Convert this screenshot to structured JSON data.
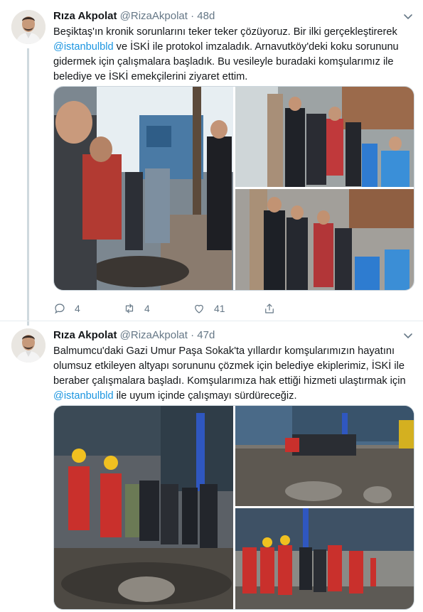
{
  "tweets": [
    {
      "author_name": "Rıza Akpolat",
      "handle": "@RizaAkpolat",
      "separator": "·",
      "time": "48d",
      "text_parts": {
        "p1": "Beşiktaş'ın kronik sorunlarını teker teker çözüyoruz. Bir ilki gerçekleştirerek",
        "mention1": "@istanbulbld",
        "p2": " ve İSKİ ile protokol imzaladık. Arnavutköy'deki koku sorununu gidermek için çalışmalara başladık. Bu vesileyle buradaki komşularımız ile belediye ve İSKİ emekçilerini ziyaret ettim."
      },
      "actions": {
        "reply": "4",
        "retweet": "4",
        "like": "41"
      },
      "media_icon_names": [
        "photo-workers-manhole",
        "photo-officials-group",
        "photo-officials-group-closeup"
      ]
    },
    {
      "author_name": "Rıza Akpolat",
      "handle": "@RizaAkpolat",
      "separator": "·",
      "time": "47d",
      "text_parts": {
        "p1": "Balmumcu'daki Gazi Umur Paşa Sokak'ta yıllardır komşularımızın hayatını olumsuz etkileyen altyapı sorununu çözmek için belediye ekiplerimiz, İSKİ ile beraber çalışmalara başladı. Komşularımıza hak ettiği hizmeti ulaştırmak için ",
        "mention1": "@istanbulbld",
        "p2": " ile uyum içinde çalışmayı sürdüreceğiz."
      },
      "media_icon_names": [
        "photo-construction-site-workers",
        "photo-excavation-pipes",
        "photo-workers-street"
      ]
    }
  ],
  "colors": {
    "link": "#1b95e0",
    "secondary": "#657786",
    "border": "#e6ecf0"
  }
}
